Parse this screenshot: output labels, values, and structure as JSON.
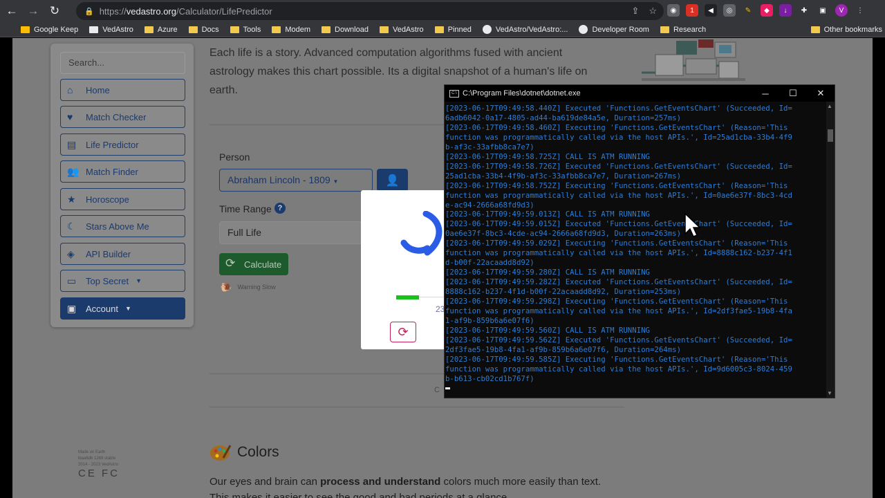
{
  "browser": {
    "url_prefix": "https://",
    "url_host": "vedastro.org",
    "url_path": "/Calculator/LifePredictor",
    "profile_letter": "V",
    "ext_badge": "1",
    "bookmarks": [
      "Google Keep",
      "VedAstro",
      "Azure",
      "Docs",
      "Tools",
      "Modem",
      "Download",
      "VedAstro",
      "Pinned",
      "VedAstro/VedAstro:...",
      "Developer Room",
      "Research"
    ],
    "other_bookmarks": "Other bookmarks"
  },
  "sidebar": {
    "search_placeholder": "Search...",
    "items": [
      {
        "label": "Home",
        "icon": "home-icon"
      },
      {
        "label": "Match Checker",
        "icon": "heart-arrow-icon"
      },
      {
        "label": "Life Predictor",
        "icon": "book-icon"
      },
      {
        "label": "Match Finder",
        "icon": "people-icon"
      },
      {
        "label": "Horoscope",
        "icon": "star-card-icon"
      },
      {
        "label": "Stars Above Me",
        "icon": "moon-icon"
      },
      {
        "label": "API Builder",
        "icon": "eye-code-icon"
      },
      {
        "label": "Top Secret",
        "icon": "laptop-icon"
      },
      {
        "label": "Account",
        "icon": "account-card-icon"
      }
    ]
  },
  "intro_text": "Each life is a story. Advanced computation algorithms fused with ancient astrology makes this chart possible. Its a digital snapshot of a human's life on earth.",
  "form": {
    "person_label": "Person",
    "person_value": "Abraham Lincoln - 1809",
    "time_range_label": "Time Range",
    "time_range_value": "Full Life",
    "calculate_label": "Calculate",
    "warning_text": "Warning Slow"
  },
  "modal": {
    "number_fragment": "23"
  },
  "page_fragment": "C",
  "footer": {
    "line1": "Made on Earth",
    "line2": "lbaa6db 1269 stable",
    "line3": "2014 - 2023 VedAstro",
    "certs": "CE FC"
  },
  "colors_section": {
    "title": "Colors",
    "text_before": "Our eyes and brain can ",
    "text_bold": "process and understand",
    "text_after": " colors much more easily than text.",
    "text_line2": "This makes it easier to see the good and bad periods at a glance."
  },
  "console": {
    "title": "C:\\Program Files\\dotnet\\dotnet.exe",
    "lines": [
      "[2023-06-17T09:49:58.440Z] Executed 'Functions.GetEventsChart' (Succeeded, Id=",
      "6adb6042-0a17-4805-ad44-ba619de84a5e, Duration=257ms)",
      "[2023-06-17T09:49:58.460Z] Executing 'Functions.GetEventsChart' (Reason='This",
      "function was programmatically called via the host APIs.', Id=25ad1cba-33b4-4f9",
      "b-af3c-33afbb8ca7e7)",
      "[2023-06-17T09:49:58.725Z] CALL IS ATM RUNNING",
      "[2023-06-17T09:49:58.726Z] Executed 'Functions.GetEventsChart' (Succeeded, Id=",
      "25ad1cba-33b4-4f9b-af3c-33afbb8ca7e7, Duration=267ms)",
      "[2023-06-17T09:49:58.752Z] Executing 'Functions.GetEventsChart' (Reason='This",
      "function was programmatically called via the host APIs.', Id=0ae6e37f-8bc3-4cd",
      "e-ac94-2666a68fd9d3)",
      "[2023-06-17T09:49:59.013Z] CALL IS ATM RUNNING",
      "[2023-06-17T09:49:59.015Z] Executed 'Functions.GetEventsChart' (Succeeded, Id=",
      "0ae6e37f-8bc3-4cde-ac94-2666a68fd9d3, Duration=263ms)",
      "[2023-06-17T09:49:59.029Z] Executing 'Functions.GetEventsChart' (Reason='This",
      "function was programmatically called via the host APIs.', Id=8888c162-b237-4f1",
      "d-b00f-22acaadd8d92)",
      "[2023-06-17T09:49:59.280Z] CALL IS ATM RUNNING",
      "[2023-06-17T09:49:59.282Z] Executed 'Functions.GetEventsChart' (Succeeded, Id=",
      "8888c162-b237-4f1d-b00f-22acaadd8d92, Duration=253ms)",
      "[2023-06-17T09:49:59.298Z] Executing 'Functions.GetEventsChart' (Reason='This",
      "function was programmatically called via the host APIs.', Id=2df3fae5-19b8-4fa",
      "1-af9b-859b6a6e07f6)",
      "[2023-06-17T09:49:59.560Z] CALL IS ATM RUNNING",
      "[2023-06-17T09:49:59.562Z] Executed 'Functions.GetEventsChart' (Succeeded, Id=",
      "2df3fae5-19b8-4fa1-af9b-859b6a6e07f6, Duration=264ms)",
      "[2023-06-17T09:49:59.585Z] Executing 'Functions.GetEventsChart' (Reason='This",
      "function was programmatically called via the host APIs.', Id=9d6005c3-8024-459",
      "b-b613-cb02cd1b767f)"
    ]
  },
  "colors": {
    "console_text": "#2e7dd3",
    "calculate_green": "#1d5a2c",
    "primary_blue": "#1c3b6d",
    "progress_green": "#18c21a",
    "reload_red": "#c5205a"
  },
  "loading": {
    "progress_fraction": 0.37
  }
}
